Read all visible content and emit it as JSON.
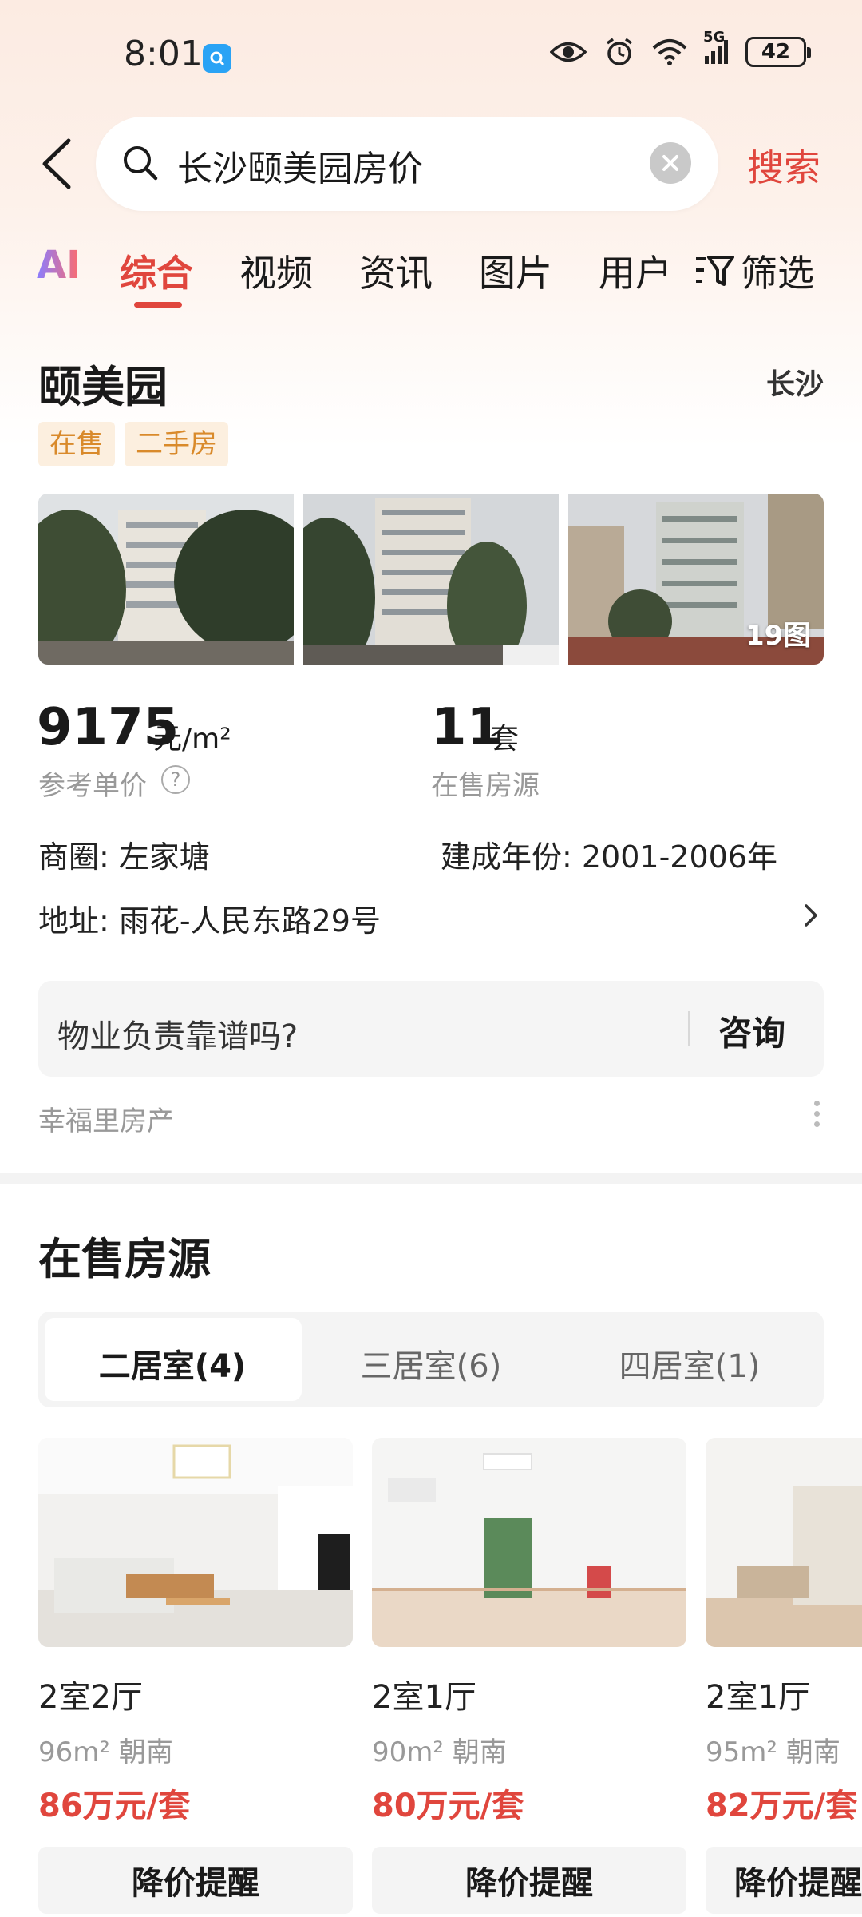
{
  "status_bar": {
    "time": "8:01",
    "battery": "42",
    "network": "5G"
  },
  "search": {
    "query": "长沙颐美园房价",
    "button": "搜索"
  },
  "tabs": {
    "ai": "AI",
    "items": [
      "综合",
      "视频",
      "资讯",
      "图片",
      "用户"
    ],
    "active_index": 0,
    "filter": "筛选"
  },
  "property": {
    "name": "颐美园",
    "city": "长沙",
    "tags": [
      "在售",
      "二手房"
    ],
    "photo_count": "19图",
    "price": {
      "value": "9175",
      "unit": "元/m²",
      "label": "参考单价",
      "help": "?"
    },
    "listings": {
      "value": "11",
      "unit": "套",
      "label": "在售房源"
    },
    "district": "商圈: 左家塘",
    "built_years": "建成年份: 2001-2006年",
    "address": "地址: 雨花-人民东路29号",
    "consult": {
      "question": "物业负责靠谱吗?",
      "button": "咨询"
    },
    "agency": "幸福里房产"
  },
  "for_sale": {
    "title": "在售房源",
    "room_tabs": [
      "二居室(4)",
      "三居室(6)",
      "四居室(1)"
    ],
    "active_room_tab": 0,
    "cards": [
      {
        "title": "2室2厅",
        "meta": "96m² 朝南",
        "price": "86万元/套",
        "button": "降价提醒"
      },
      {
        "title": "2室1厅",
        "meta": "90m² 朝南",
        "price": "80万元/套",
        "button": "降价提醒"
      },
      {
        "title": "2室1厅",
        "meta": "95m² 朝南",
        "price": "82万元/套",
        "button": "降价提醒"
      }
    ]
  },
  "colors": {
    "accent": "#e0463d",
    "tag_bg": "#fcefdf",
    "tag_text": "#d98a2b"
  }
}
